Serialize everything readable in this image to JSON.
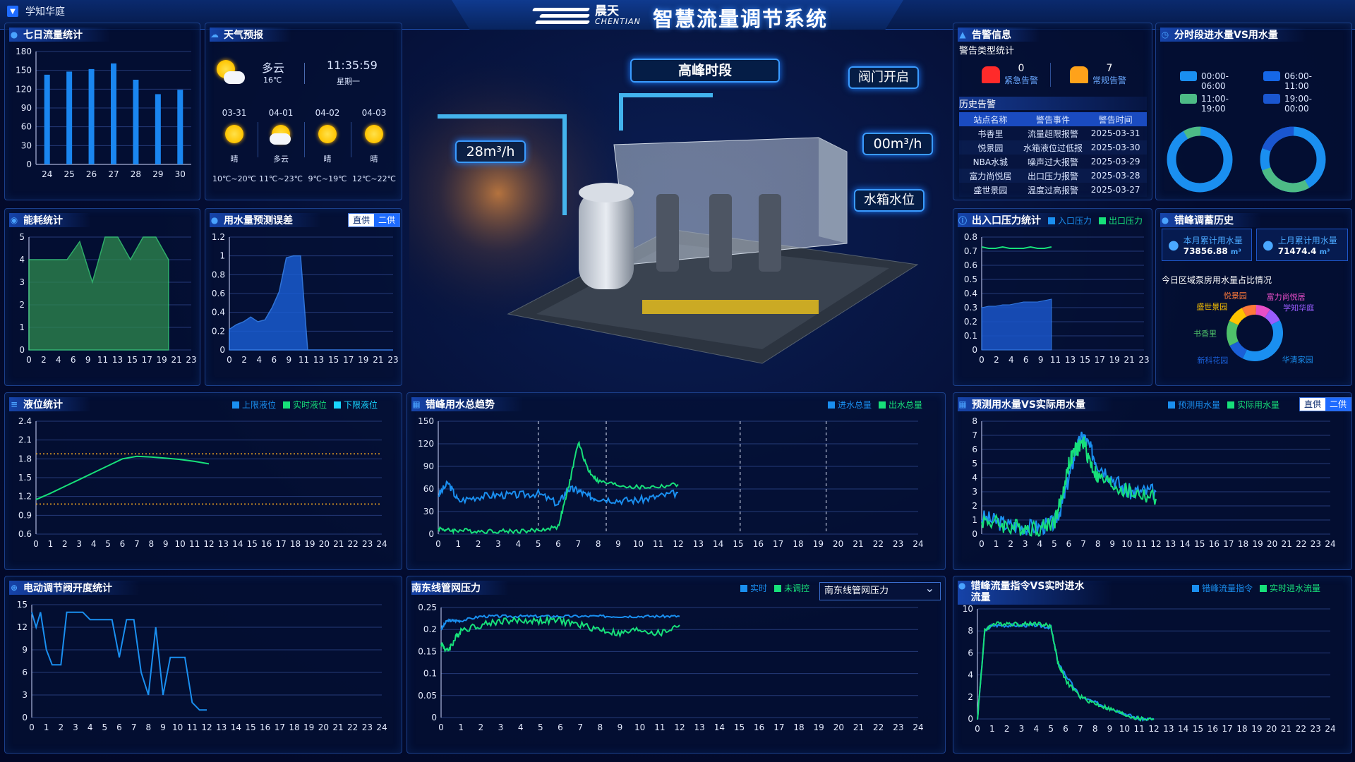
{
  "header": {
    "site_name": "学知华庭",
    "brand_cn": "晨天",
    "brand_en": "CHENTIAN",
    "title": "智慧流量调节系统"
  },
  "colors": {
    "accent": "#1e6bff",
    "green": "#17e07a",
    "cyan": "#19d5ff",
    "orange": "#ff8a2a",
    "bar_blue": "#1a86f0"
  },
  "center": {
    "peak_label": "高峰时段",
    "flow_label": "28m³/h",
    "valve_label": "阀门开启",
    "flow2_label": "00m³/h",
    "tank_label": "水箱水位"
  },
  "seven_day": {
    "title": "七日流量统计"
  },
  "weather": {
    "title": "天气预报",
    "now_cond": "多云",
    "now_temp": "16℃",
    "time": "11:35:59",
    "weekday": "星期一",
    "days": [
      {
        "date": "03-31",
        "cond": "晴",
        "range": "10℃~20℃",
        "icon": "sunny-icon"
      },
      {
        "date": "04-01",
        "cond": "多云",
        "range": "11℃~23℃",
        "icon": "cloudy-icon"
      },
      {
        "date": "04-02",
        "cond": "晴",
        "range": "9℃~19℃",
        "icon": "sunny-icon"
      },
      {
        "date": "04-03",
        "cond": "晴",
        "range": "12℃~22℃",
        "icon": "sunny-icon"
      }
    ]
  },
  "alarm": {
    "title": "告警信息",
    "type_title": "警告类型统计",
    "urgent_count": "0",
    "urgent_label": "紧急告警",
    "normal_count": "7",
    "normal_label": "常规告警",
    "history_title": "历史告警",
    "cols": [
      "站点名称",
      "警告事件",
      "警告时间"
    ],
    "rows": [
      [
        "书香里",
        "流量超限报警",
        "2025-03-31"
      ],
      [
        "悦景园",
        "水箱液位过低报",
        "2025-03-30"
      ],
      [
        "NBA水城",
        "噪声过大报警",
        "2025-03-29"
      ],
      [
        "富力尚悦居",
        "出口压力报警",
        "2025-03-28"
      ],
      [
        "盛世景园",
        "温度过高报警",
        "2025-03-27"
      ]
    ]
  },
  "period": {
    "title": "分时段进水量VS用水量",
    "legend": [
      "00:00-06:00",
      "06:00-11:00",
      "11:00-19:00",
      "19:00-00:00"
    ]
  },
  "energy": {
    "title": "能耗统计"
  },
  "forecast_err": {
    "title": "用水量预测误差",
    "toggle": [
      "直供",
      "二供"
    ]
  },
  "pressure": {
    "title": "出入口压力统计",
    "legend": [
      "入口压力",
      "出口压力"
    ]
  },
  "peak_hist": {
    "title": "错峰调蓄历史",
    "month_label": "本月累计用水量",
    "month_value": "73856.88",
    "last_label": "上月累计用水量",
    "last_value": "71474.4",
    "unit": "m³",
    "pie_title": "今日区域泵房用水量占比情况",
    "pie_labels": [
      "学知华庭",
      "富力尚悦居",
      "悦景园",
      "盛世景园",
      "书香里",
      "新科花园",
      "华清家园"
    ]
  },
  "level": {
    "title": "液位统计",
    "legend": [
      "上限液位",
      "实时液位",
      "下限液位"
    ]
  },
  "trend": {
    "title": "错峰用水总趋势",
    "legend": [
      "进水总量",
      "出水总量"
    ]
  },
  "predict": {
    "title": "预测用水量VS实际用水量",
    "legend": [
      "预测用水量",
      "实际用水量"
    ],
    "toggle": [
      "直供",
      "二供"
    ]
  },
  "valve": {
    "title": "电动调节阀开度统计"
  },
  "pipe": {
    "title": "南东线管网压力",
    "legend": [
      "实时",
      "未调控"
    ],
    "select": "南东线管网压力"
  },
  "cmd": {
    "title": "错峰流量指令VS实时进水流量",
    "legend": [
      "错峰流量指令",
      "实时进水流量"
    ]
  },
  "chart_data": [
    {
      "type": "bar",
      "title": "七日流量统计",
      "categories": [
        "24",
        "25",
        "26",
        "27",
        "28",
        "29",
        "30"
      ],
      "values": [
        143,
        148,
        152,
        161,
        135,
        112,
        119
      ],
      "ylim": [
        0,
        180
      ],
      "yticks": [
        0,
        30,
        60,
        90,
        120,
        150,
        180
      ]
    },
    {
      "type": "area",
      "title": "能耗统计",
      "x": [
        0,
        1,
        2,
        3,
        4,
        5,
        6,
        7,
        8,
        9,
        10,
        11
      ],
      "values": [
        4,
        4,
        4,
        4,
        4.8,
        3,
        5,
        5,
        4,
        5,
        5,
        4
      ],
      "xticks": [
        "0",
        "2",
        "4",
        "6",
        "9",
        "11",
        "13",
        "15",
        "17",
        "19",
        "21",
        "23"
      ],
      "ylim": [
        0,
        5
      ]
    },
    {
      "type": "area",
      "title": "用水量预测误差",
      "values": [
        0.22,
        0.27,
        0.3,
        0.35,
        0.3,
        0.32,
        0.45,
        0.62,
        0.98,
        1.0,
        1.0,
        0,
        0,
        0,
        0,
        0,
        0,
        0,
        0,
        0,
        0,
        0,
        0,
        0
      ],
      "xticks": [
        "0",
        "2",
        "4",
        "6",
        "9",
        "11",
        "13",
        "15",
        "17",
        "19",
        "21",
        "23"
      ],
      "ylim": [
        0,
        1.2
      ]
    },
    {
      "type": "area",
      "title": "出入口压力统计",
      "series": [
        {
          "name": "入口压力",
          "values": [
            0.3,
            0.31,
            0.31,
            0.32,
            0.32,
            0.33,
            0.34,
            0.34,
            0.34,
            0.35,
            0.36
          ]
        },
        {
          "name": "出口压力",
          "values": [
            0.73,
            0.72,
            0.72,
            0.73,
            0.72,
            0.72,
            0.72,
            0.73,
            0.72,
            0.72,
            0.73
          ]
        }
      ],
      "xticks": [
        "0",
        "2",
        "4",
        "6",
        "9",
        "11",
        "13",
        "15",
        "17",
        "19",
        "21",
        "23"
      ],
      "ylim": [
        0,
        0.8
      ]
    },
    {
      "type": "line",
      "title": "液位统计",
      "x": [
        0,
        1,
        2,
        3,
        4,
        5,
        6,
        7,
        8,
        9,
        10,
        11,
        12
      ],
      "series": [
        {
          "name": "实时液位",
          "values": [
            1.15,
            1.25,
            1.36,
            1.47,
            1.58,
            1.69,
            1.8,
            1.84,
            1.83,
            1.81,
            1.79,
            1.76,
            1.72
          ]
        }
      ],
      "upper": 1.88,
      "lower": 1.08,
      "ylim": [
        0.6,
        2.4
      ],
      "xticks": [
        "0",
        "1",
        "2",
        "3",
        "4",
        "5",
        "6",
        "7",
        "8",
        "9",
        "10",
        "11",
        "12",
        "13",
        "14",
        "15",
        "16",
        "17",
        "18",
        "19",
        "20",
        "21",
        "22",
        "23",
        "24"
      ]
    },
    {
      "type": "line",
      "title": "错峰用水总趋势",
      "x": [
        0,
        0.5,
        1,
        2,
        3,
        4,
        5,
        6,
        6.5,
        7,
        7.5,
        8,
        9,
        10,
        11,
        12
      ],
      "series": [
        {
          "name": "进水总量",
          "values": [
            52,
            68,
            44,
            50,
            52,
            52,
            54,
            40,
            60,
            58,
            50,
            48,
            45,
            45,
            50,
            55
          ]
        },
        {
          "name": "出水总量",
          "values": [
            8,
            5,
            5,
            4,
            4,
            4,
            5,
            10,
            60,
            122,
            85,
            70,
            65,
            62,
            63,
            66
          ]
        }
      ],
      "ylim": [
        0,
        150
      ],
      "dashed_x": [
        5,
        8.4,
        15.1,
        19.4
      ]
    },
    {
      "type": "line",
      "title": "预测用水量VS实际用水量",
      "x": [
        0,
        1,
        2,
        3,
        4,
        5,
        5.5,
        6,
        6.5,
        7,
        7.5,
        8,
        9,
        10,
        11,
        12
      ],
      "series": [
        {
          "name": "预测用水量",
          "values": [
            1.2,
            0.9,
            0.6,
            0.5,
            0.5,
            0.8,
            2,
            4,
            6,
            7,
            6,
            5,
            4,
            3,
            3,
            3
          ]
        },
        {
          "name": "实际用水量",
          "values": [
            1,
            0.8,
            0.5,
            0.5,
            0.4,
            0.9,
            2.5,
            5,
            6,
            6.5,
            5,
            4,
            3.5,
            3,
            2.8,
            2.5
          ]
        }
      ],
      "ylim": [
        0,
        8
      ]
    },
    {
      "type": "line",
      "title": "电动调节阀开度统计",
      "x": [
        0,
        0.3,
        0.6,
        1,
        1.4,
        2,
        2.4,
        3,
        3.5,
        4,
        5,
        5.5,
        6,
        6.5,
        7,
        7.5,
        8,
        8.5,
        9,
        9.5,
        10,
        10.5,
        11,
        11.5,
        12
      ],
      "series": [
        {
          "name": "开度",
          "values": [
            14,
            12,
            14,
            9,
            7,
            7,
            14,
            14,
            14,
            13,
            13,
            13,
            8,
            13,
            13,
            6,
            3,
            12,
            3,
            8,
            8,
            8,
            2,
            1,
            1
          ]
        }
      ],
      "ylim": [
        0,
        15
      ]
    },
    {
      "type": "line",
      "title": "南东线管网压力",
      "x": [
        0,
        0.3,
        0.6,
        1,
        2,
        3,
        4,
        5,
        6,
        7,
        8,
        9,
        10,
        11,
        12
      ],
      "series": [
        {
          "name": "实时",
          "values": [
            0.2,
            0.22,
            0.22,
            0.22,
            0.23,
            0.23,
            0.23,
            0.23,
            0.23,
            0.23,
            0.23,
            0.23,
            0.23,
            0.23,
            0.23
          ]
        },
        {
          "name": "未调控",
          "values": [
            0.17,
            0.15,
            0.17,
            0.2,
            0.21,
            0.22,
            0.22,
            0.22,
            0.22,
            0.21,
            0.2,
            0.19,
            0.2,
            0.19,
            0.21
          ]
        }
      ],
      "ylim": [
        0,
        0.25
      ]
    },
    {
      "type": "line",
      "title": "错峰流量指令VS实时进水流量",
      "x": [
        0,
        0.5,
        1,
        2,
        3,
        4,
        5,
        5.5,
        6,
        7,
        8,
        9,
        10,
        11,
        12
      ],
      "series": [
        {
          "name": "错峰流量指令",
          "values": [
            0,
            8,
            8.5,
            8.5,
            8.5,
            8.5,
            8.3,
            5,
            4,
            2,
            1.5,
            1,
            0.5,
            0,
            0
          ]
        },
        {
          "name": "实时进水流量",
          "values": [
            0,
            8,
            8.6,
            8.7,
            8.6,
            8.7,
            8.4,
            5,
            3.5,
            2,
            1.4,
            0.9,
            0.4,
            0,
            0
          ]
        }
      ],
      "ylim": [
        0,
        10
      ]
    },
    {
      "type": "pie",
      "title": "今日区域泵房用水量占比情况",
      "labels": [
        "华清家园",
        "新科花园",
        "书香里",
        "盛世景园",
        "悦景园",
        "富力尚悦居",
        "学知华庭"
      ],
      "values": [
        38,
        10,
        14,
        10,
        8,
        8,
        8
      ]
    }
  ]
}
